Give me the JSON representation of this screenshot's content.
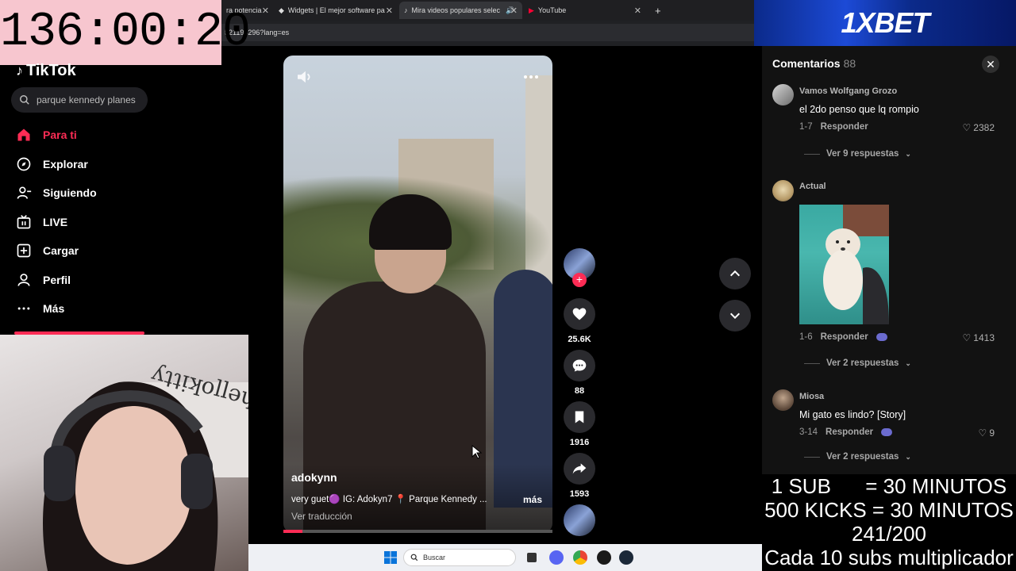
{
  "timer": "136:00:20",
  "browser": {
    "tabs": [
      {
        "label": "ra potencia"
      },
      {
        "label": "Widgets | El mejor software pa"
      },
      {
        "label": "Mira videos populares selec"
      },
      {
        "label": "YouTube"
      }
    ],
    "url": "521196296?lang=es"
  },
  "sidebar": {
    "logo": "TikTok",
    "search_value": "parque kennedy planes",
    "items": [
      {
        "label": "Para ti",
        "icon": "home-icon"
      },
      {
        "label": "Explorar",
        "icon": "compass-icon"
      },
      {
        "label": "Siguiendo",
        "icon": "user-follow-icon"
      },
      {
        "label": "LIVE",
        "icon": "live-icon"
      },
      {
        "label": "Cargar",
        "icon": "upload-icon"
      },
      {
        "label": "Perfil",
        "icon": "person-icon"
      },
      {
        "label": "Más",
        "icon": "more-icon"
      }
    ]
  },
  "video": {
    "author": "adokynn",
    "caption": "very guet🟣 IG: Adokyn7 📍 Parque Kennedy ...",
    "more": "más",
    "translate": "Ver traducción",
    "progress": 0.07,
    "likes": "25.6K",
    "comments": "88",
    "saves": "1916",
    "shares": "1593"
  },
  "comments_panel": {
    "title": "Comentarios",
    "count": "88",
    "comments": [
      {
        "user": "Vamos Wolfgang Grozo",
        "text": "el 2do penso que lq rompio",
        "date": "1-7",
        "reply": "Responder",
        "likes": "2382",
        "replies": "Ver 9 respuestas"
      },
      {
        "user": "Actual",
        "text": "",
        "date": "1-6",
        "reply": "Responder",
        "likes": "1413",
        "replies": "Ver 2 respuestas"
      },
      {
        "user": "Miosa",
        "text": "Mi gato es lindo? [Story]",
        "date": "3-14",
        "reply": "Responder",
        "likes": "9",
        "replies": "Ver 2 respuestas"
      }
    ]
  },
  "ad": {
    "text": "1XBET"
  },
  "taskbar": {
    "search_placeholder": "Buscar"
  },
  "subathon": {
    "line1": "1 SUB      = 30 MINUTOS",
    "line2": "500 KICKS = 30 MINUTOS",
    "line3": "241/200",
    "line4": "Cada 10 subs multiplicador"
  },
  "colors": {
    "accent": "#fe2c55",
    "timer_bg": "#f7c6cf"
  }
}
